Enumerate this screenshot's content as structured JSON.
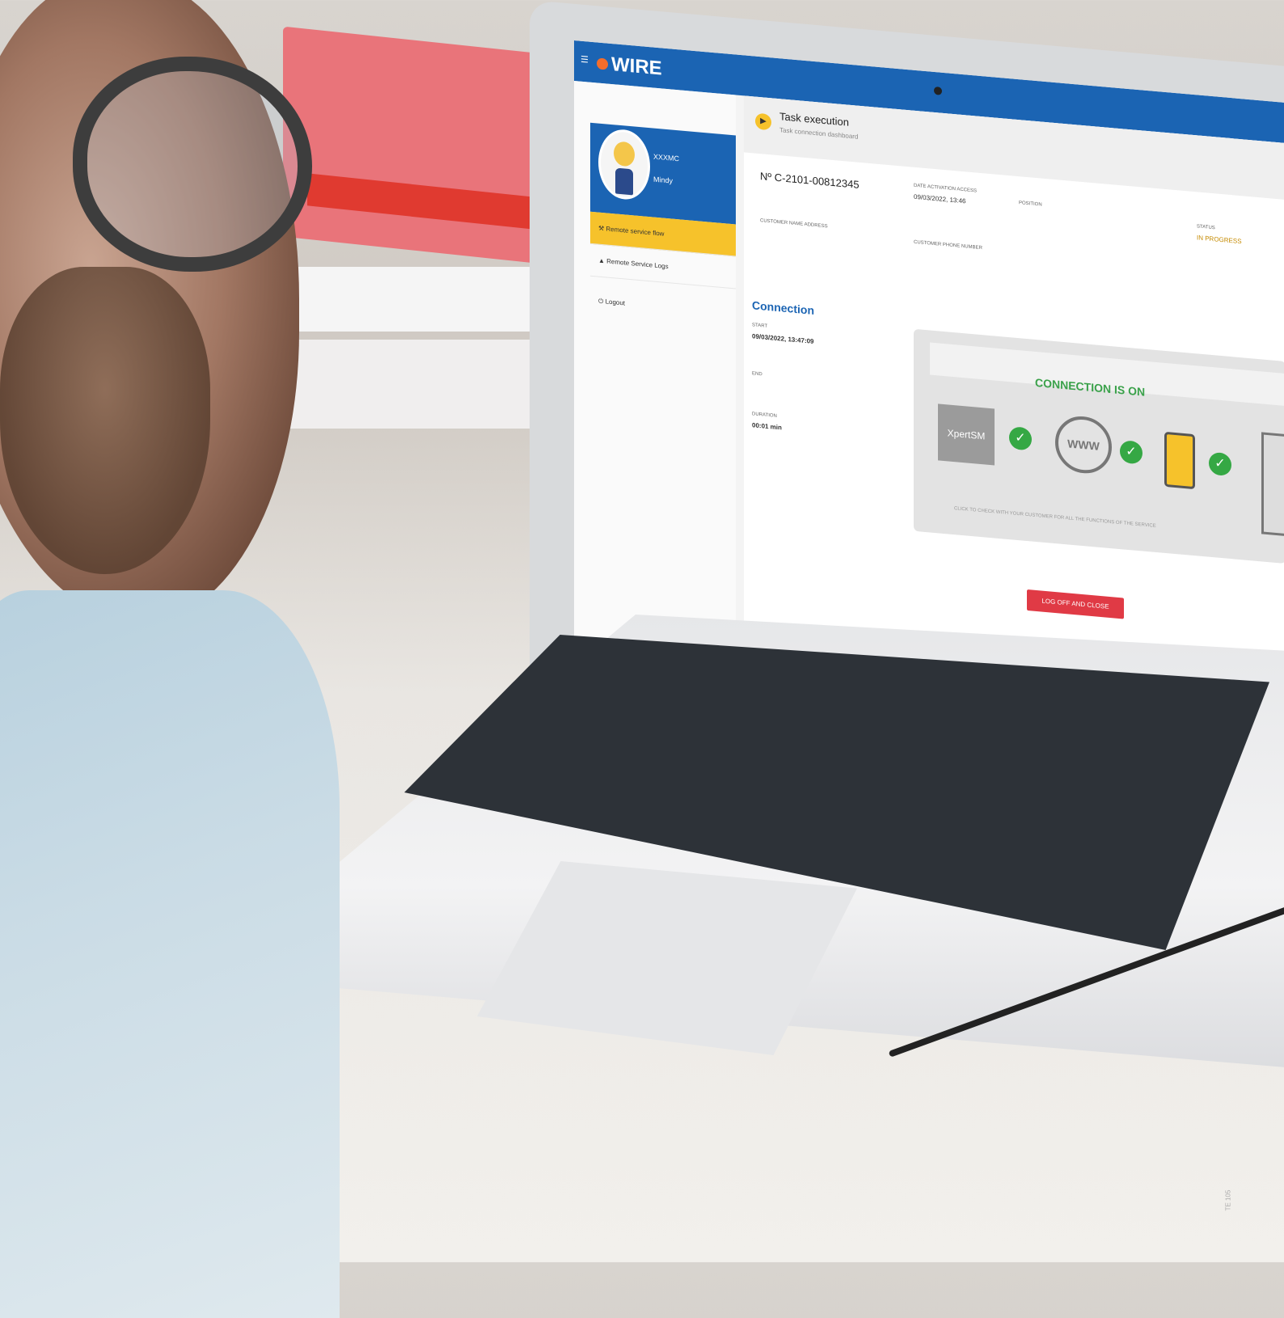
{
  "app": {
    "logo_text": "WIRE",
    "brand_color": "#1b64b3",
    "accent_color": "#f6c22b"
  },
  "profile": {
    "name": "XXXMC",
    "role": "Mindy"
  },
  "sidebar": {
    "items": [
      {
        "label": "Remote service flow",
        "icon": "wrench-icon"
      },
      {
        "label": "Remote Service Logs",
        "icon": "user-icon"
      },
      {
        "label": "Logout",
        "icon": "power-icon"
      }
    ]
  },
  "task": {
    "title": "Task execution",
    "subtitle": "Task connection dashboard"
  },
  "order": {
    "number": "Nº C-2101-00812345",
    "date_label": "DATE ACTIVATION ACCESS",
    "date_value": "09/03/2022, 13:46",
    "owner_label": "POSITION",
    "status_label": "STATUS",
    "status_value": "IN PROGRESS",
    "customer_label": "CUSTOMER NAME ADDRESS",
    "contact_label": "CUSTOMER PHONE NUMBER"
  },
  "connection": {
    "section_title": "Connection",
    "start_label": "START",
    "start_value": "09/03/2022, 13:47:09",
    "end_label": "END",
    "duration_label": "DURATION",
    "duration_value": "00:01 min",
    "panel_title": "CONNECTION IS ON",
    "source_label": "XpertSM",
    "www_label": "WWW",
    "footnote": "CLICK TO CHECK WITH YOUR CUSTOMER FOR ALL THE FUNCTIONS OF THE SERVICE"
  },
  "buttons": {
    "logoff": "LOG OFF AND CLOSE SESSION"
  },
  "watermark": "TE 105"
}
